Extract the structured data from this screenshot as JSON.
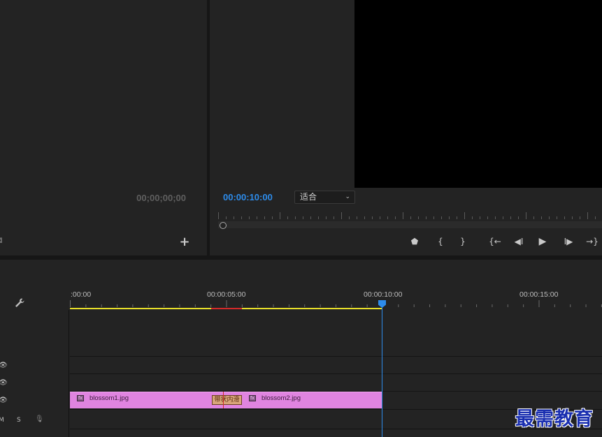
{
  "source_monitor": {
    "timecode": "00;00;00;00",
    "camera_icon": "camera-icon",
    "add_icon": "+"
  },
  "program_monitor": {
    "timecode": "00:00:10:00",
    "zoom_value": "适合",
    "zoom_chevron": "⌄",
    "transport": {
      "marker": "⬟",
      "mark_in": "{",
      "mark_out": "}",
      "go_to_in": "{←",
      "step_back": "◀I",
      "play": "▶",
      "step_forward": "I▶",
      "go_to_out": "→}"
    }
  },
  "timeline": {
    "ruler_labels": [
      ":00:00",
      "00:00:05:00",
      "00:00:10:00",
      "00:00:15:00"
    ],
    "wrench_icon": "🔧",
    "tracks": {
      "v3_eye": "👁",
      "v2_eye": "👁",
      "v1_eye": "👁",
      "a1_m": "M",
      "a1_s": "S",
      "a1_mic": "🎙"
    },
    "clips": [
      {
        "name": "blossom1.jpg",
        "fx": "fx"
      },
      {
        "name": "blossom2.jpg",
        "fx": "fx"
      }
    ],
    "transition_label": "带状内滑"
  },
  "watermark": "最需教育",
  "colors": {
    "accent_blue": "#2d8ceb",
    "work_area_yellow": "#e8e02a",
    "clip_pink": "#e084e0",
    "render_red": "#d42a2a"
  }
}
